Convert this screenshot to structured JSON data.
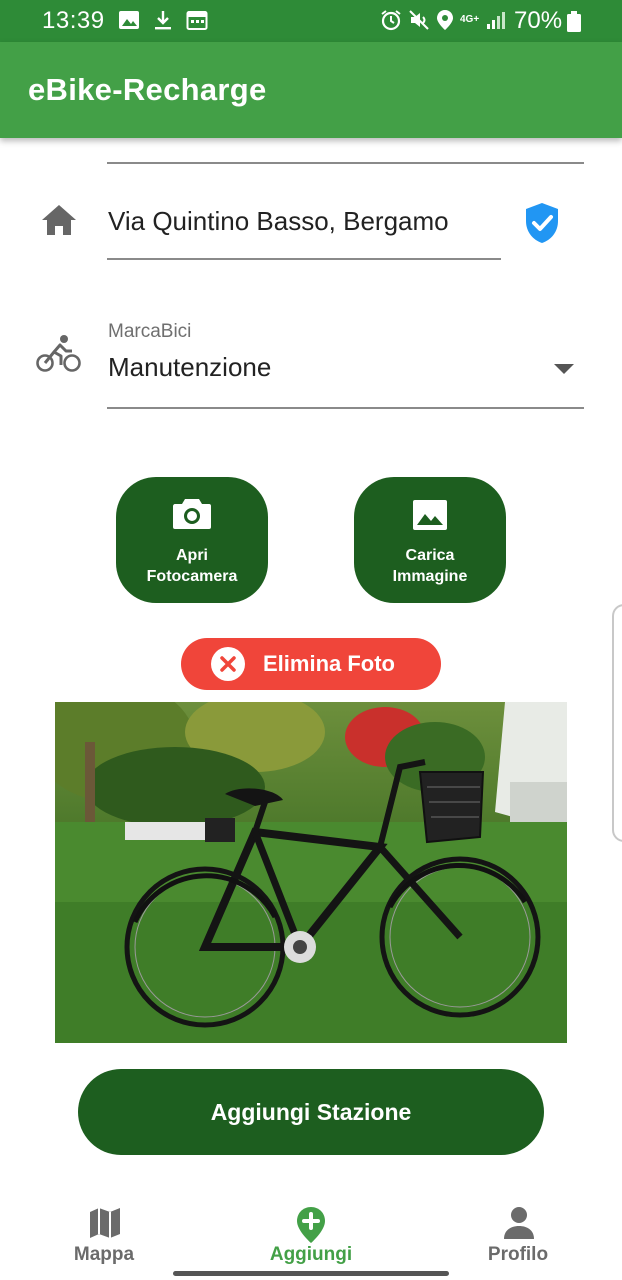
{
  "status_bar": {
    "time": "13:39",
    "battery": "70%",
    "network": "4G+"
  },
  "app_bar": {
    "title": "eBike-Recharge"
  },
  "form": {
    "address": {
      "value": "Via Quintino Basso, Bergamo",
      "icon": "home-icon",
      "verified_icon": "verified-shield-icon"
    },
    "bike_brand": {
      "label": "MarcaBici",
      "value": "Manutenzione",
      "icon": "bike-rider-icon"
    }
  },
  "photo_actions": {
    "camera_label": "Apri\nFotocamera",
    "gallery_label": "Carica\nImmagine"
  },
  "delete_photo": {
    "label": "Elimina Foto"
  },
  "submit": {
    "label": "Aggiungi Stazione"
  },
  "bottom_nav": {
    "items": [
      {
        "label": "Mappa",
        "icon": "map-icon",
        "active": false
      },
      {
        "label": "Aggiungi",
        "icon": "add-location-icon",
        "active": true
      },
      {
        "label": "Profilo",
        "icon": "person-icon",
        "active": false
      }
    ]
  },
  "colors": {
    "status_bar": "#2e8b37",
    "app_bar": "#43a047",
    "primary_dark": "#1d5e1f",
    "danger": "#f0453a",
    "verified": "#2196f3",
    "active_nav": "#43a047"
  }
}
